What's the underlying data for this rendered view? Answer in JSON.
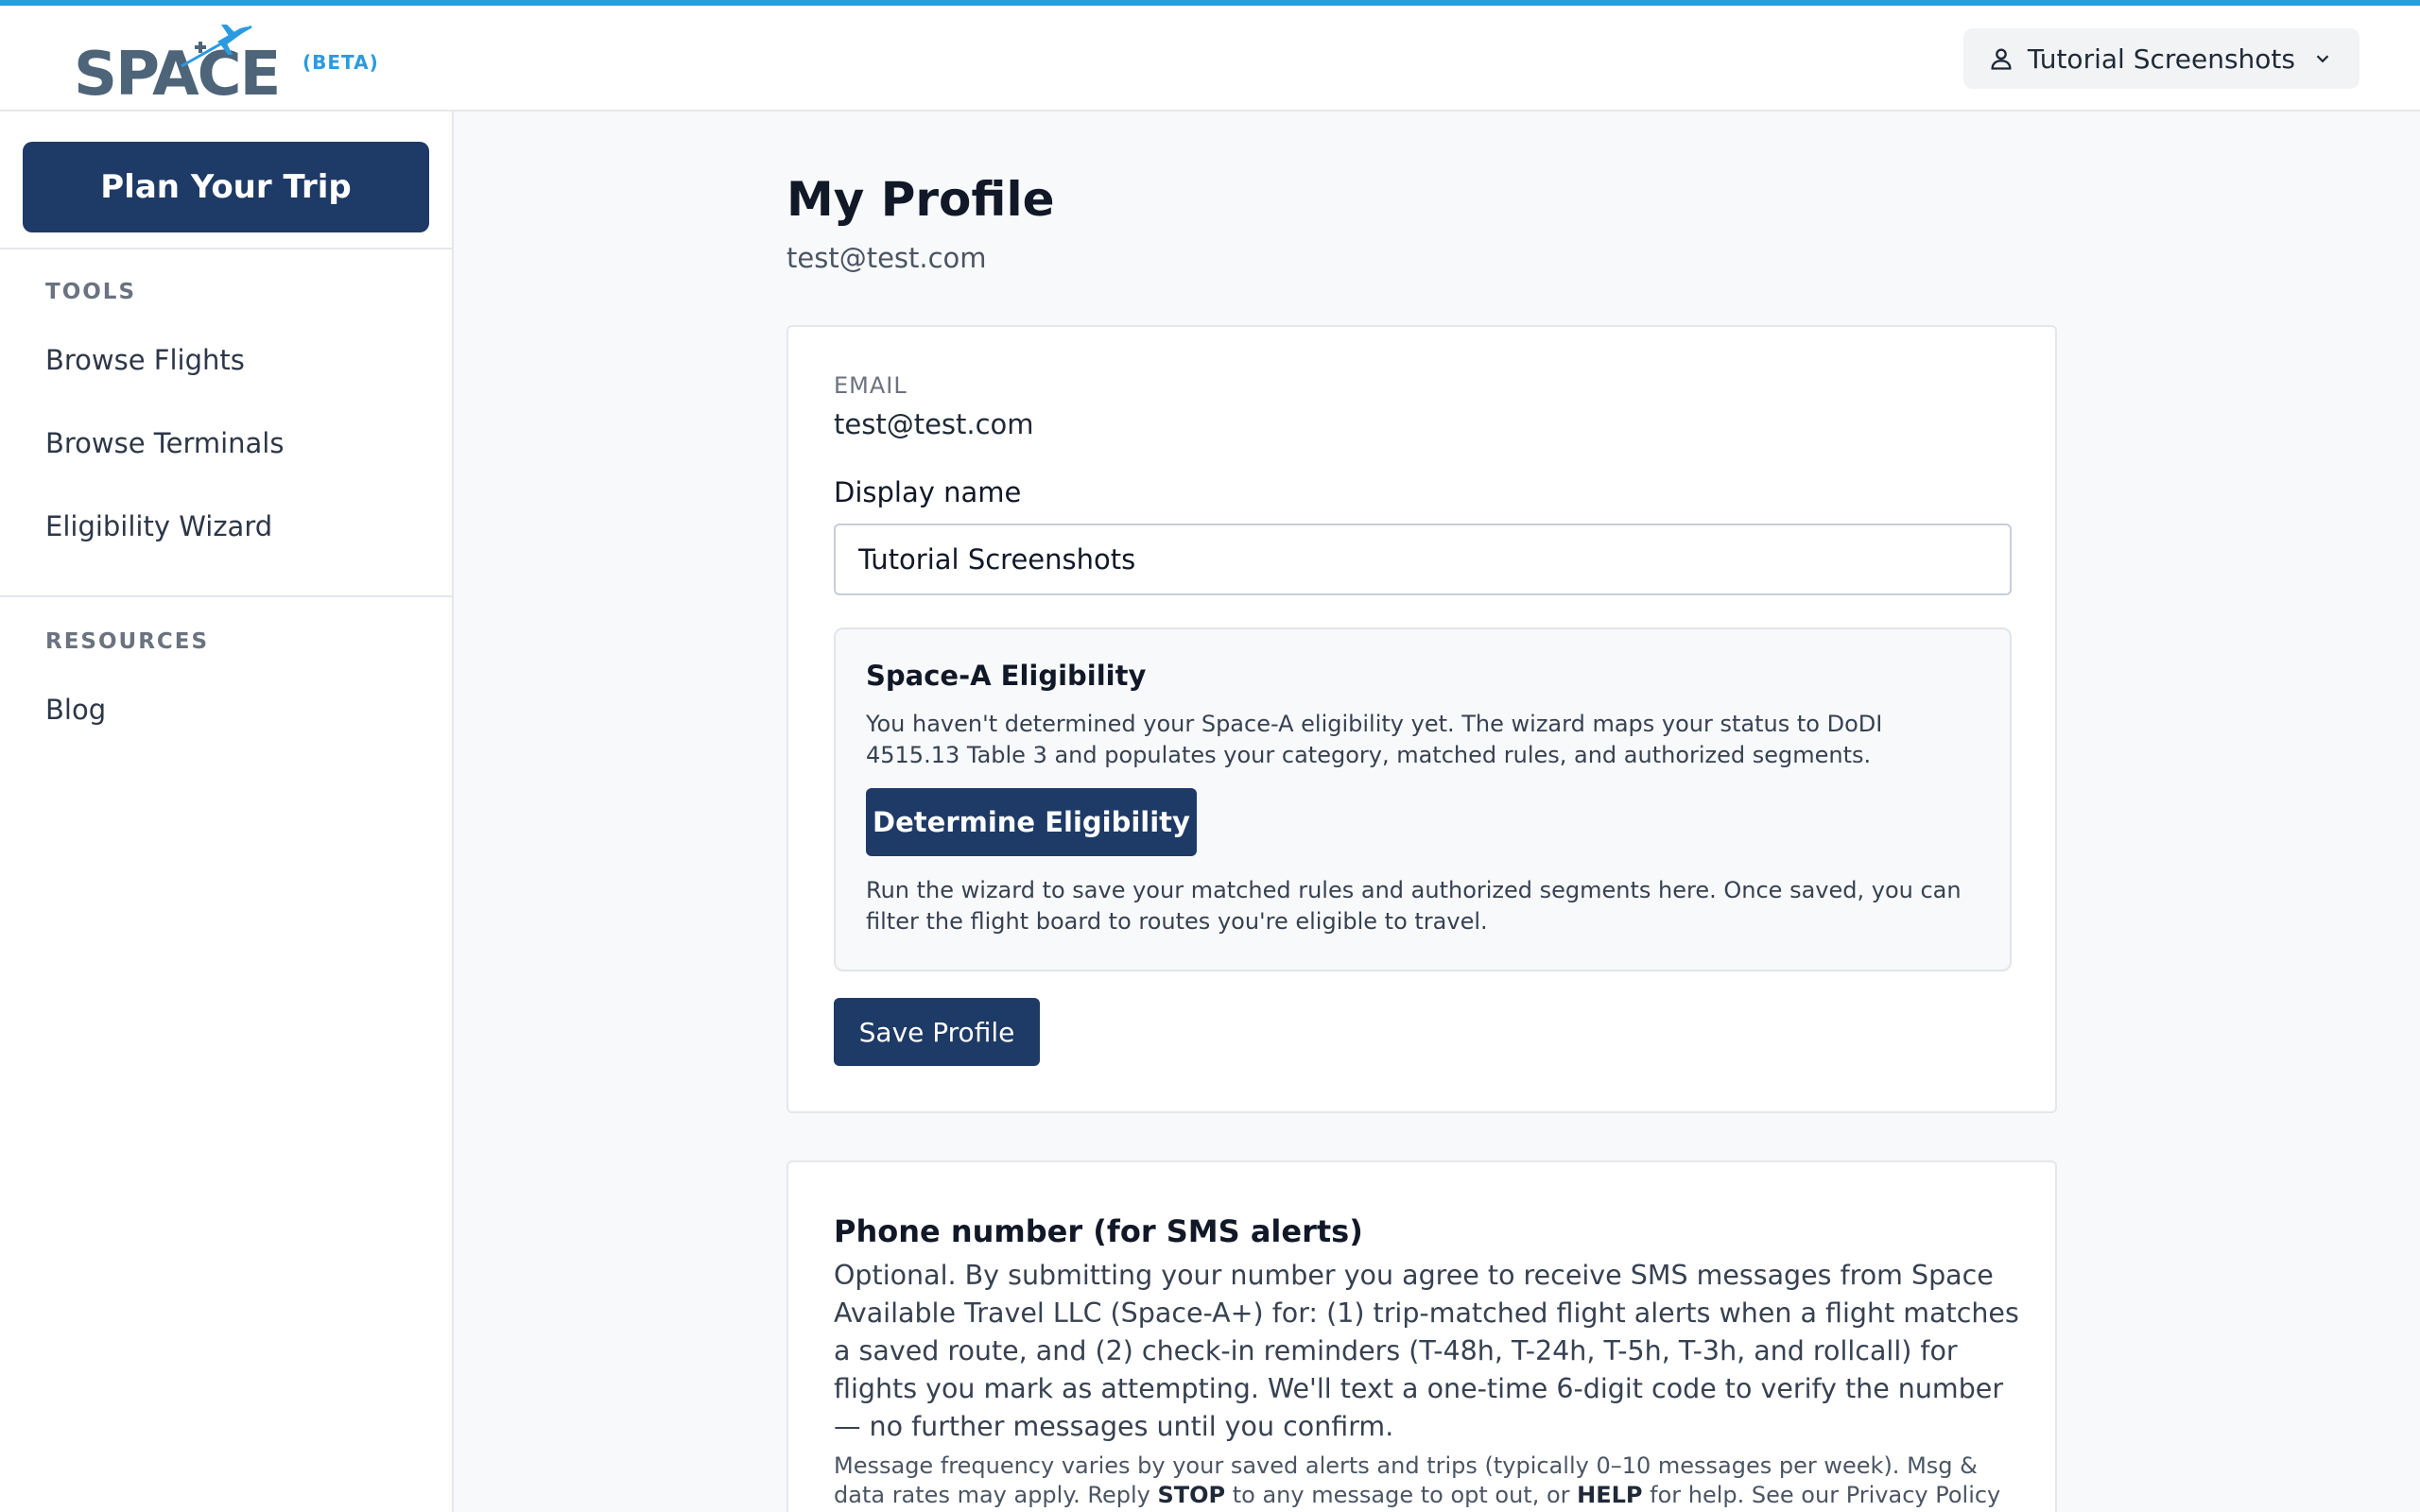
{
  "header": {
    "logo_text": "SPACE",
    "logo_badge": "(BETA)",
    "user_menu_label": "Tutorial Screenshots"
  },
  "sidebar": {
    "plan_button": "Plan Your Trip",
    "tools_title": "TOOLS",
    "tools": [
      {
        "label": "Browse Flights"
      },
      {
        "label": "Browse Terminals"
      },
      {
        "label": "Eligibility Wizard"
      }
    ],
    "resources_title": "RESOURCES",
    "resources": [
      {
        "label": "Blog"
      }
    ]
  },
  "page": {
    "title": "My Profile",
    "email": "test@test.com"
  },
  "profile_card": {
    "email_label": "EMAIL",
    "email_value": "test@test.com",
    "display_name_label": "Display name",
    "display_name_value": "Tutorial Screenshots",
    "eligibility": {
      "title": "Space-A Eligibility",
      "description": "You haven't determined your Space-A eligibility yet. The wizard maps your status to DoDI 4515.13 Table 3 and populates your category, matched rules, and authorized segments.",
      "button": "Determine Eligibility",
      "note": "Run the wizard to save your matched rules and authorized segments here. Once saved, you can filter the flight board to routes you're eligible to travel."
    },
    "save_button": "Save Profile"
  },
  "phone_card": {
    "title": "Phone number (for SMS alerts)",
    "description": "Optional. By submitting your number you agree to receive SMS messages from Space Available Travel LLC (Space-A+) for: (1) trip-matched flight alerts when a flight matches a saved route, and (2) check-in reminders (T-48h, T-24h, T-5h, T-3h, and rollcall) for flights you mark as attempting. We'll text a one-time 6-digit code to verify the number — no further messages until you confirm.",
    "fine_print_1": "Message frequency varies by your saved alerts and trips (typically 0–10 messages per week). Msg & data rates may apply. Reply ",
    "stop": "STOP",
    "fine_print_2": " to any message to opt out, or ",
    "help": "HELP",
    "fine_print_3": " for help. See our Privacy Policy and Terms."
  },
  "colors": {
    "accent": "#2b9be0",
    "primary_button": "#1e3a66",
    "logo": "#4e6478"
  },
  "icons": {
    "user_menu": "user-icon",
    "user_menu_caret": "chevron-down-icon",
    "logo_plane": "airplane-icon"
  }
}
